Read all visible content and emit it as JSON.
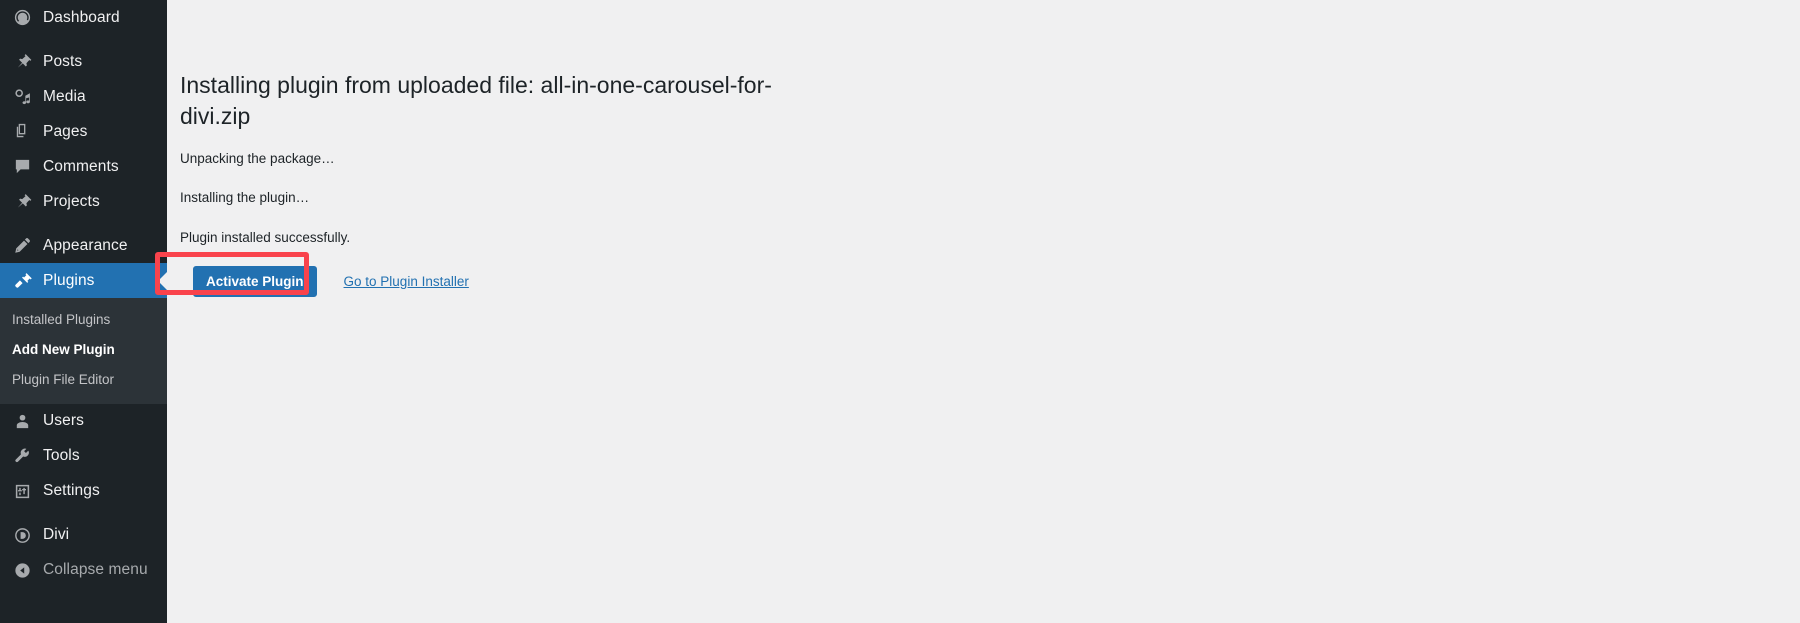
{
  "colors": {
    "sidebar_bg": "#1d2327",
    "submenu_bg": "#2c3338",
    "active_blue": "#2271b1",
    "content_bg": "#f0f0f1",
    "link_blue": "#2271b1",
    "annotation_red": "#f9434c",
    "text_dark": "#1d2327",
    "icon_gray": "#a7aaad"
  },
  "sidebar": {
    "items": [
      {
        "label": "Dashboard",
        "icon": "dashboard-icon",
        "state": "normal"
      },
      {
        "label": "Posts",
        "icon": "pin-icon",
        "state": "normal"
      },
      {
        "label": "Media",
        "icon": "media-icon",
        "state": "normal"
      },
      {
        "label": "Pages",
        "icon": "pages-icon",
        "state": "normal"
      },
      {
        "label": "Comments",
        "icon": "comments-icon",
        "state": "normal"
      },
      {
        "label": "Projects",
        "icon": "pin-icon",
        "state": "normal"
      },
      {
        "label": "Appearance",
        "icon": "paintbrush-icon",
        "state": "normal"
      },
      {
        "label": "Plugins",
        "icon": "plug-icon",
        "state": "current"
      },
      {
        "label": "Users",
        "icon": "user-icon",
        "state": "normal"
      },
      {
        "label": "Tools",
        "icon": "wrench-icon",
        "state": "normal"
      },
      {
        "label": "Settings",
        "icon": "sliders-icon",
        "state": "normal"
      },
      {
        "label": "Divi",
        "icon": "divi-icon",
        "state": "normal"
      },
      {
        "label": "Collapse menu",
        "icon": "collapse-left-icon",
        "state": "dim"
      }
    ],
    "plugins_submenu": [
      {
        "label": "Installed Plugins",
        "current": false
      },
      {
        "label": "Add New Plugin",
        "current": true
      },
      {
        "label": "Plugin File Editor",
        "current": false
      }
    ]
  },
  "main": {
    "title": "Installing plugin from uploaded file: all-in-one-carousel-for-divi.zip",
    "progress_lines": [
      "Unpacking the package…",
      "Installing the plugin…",
      "Plugin installed successfully."
    ],
    "primary_button": "Activate Plugin",
    "secondary_link": "Go to Plugin Installer"
  }
}
